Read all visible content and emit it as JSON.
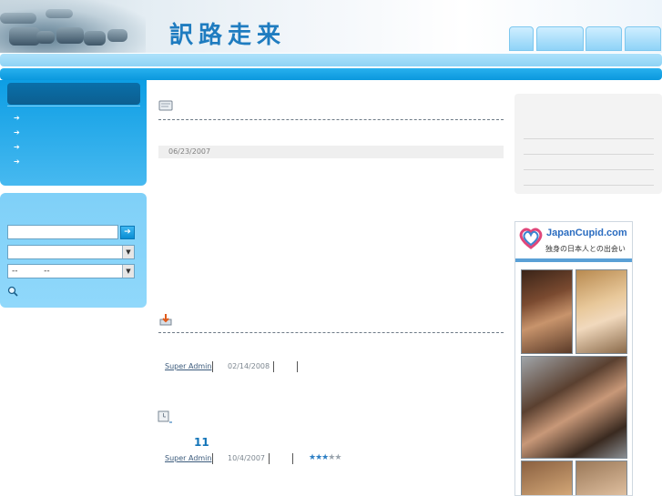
{
  "header": {
    "site_title": "訳路走来",
    "nav_tabs": [
      "",
      "",
      "",
      ""
    ]
  },
  "sidebar": {
    "menu_items": [
      "",
      "",
      "",
      ""
    ],
    "search": {
      "keyword_value": "",
      "select1_value": "",
      "date_value": "--          --"
    }
  },
  "posts": [
    {
      "date": "06/23/2007"
    },
    {
      "author": "Super Admin",
      "date": "02/14/2008"
    },
    {
      "count": "11",
      "author": "Super Admin",
      "date": "10/4/2007",
      "rating": 3,
      "rating_max": 5
    }
  ],
  "ad": {
    "brand": "JapanCupid.com",
    "tagline": "独身の日本人との出会い"
  },
  "colors": {
    "accent": "#0a98dd",
    "link": "#3c5b7c"
  },
  "icons": [
    "arrow-right-icon",
    "search-icon",
    "note-icon",
    "download-icon",
    "calendar-icon",
    "star-icon",
    "heart-icon"
  ]
}
